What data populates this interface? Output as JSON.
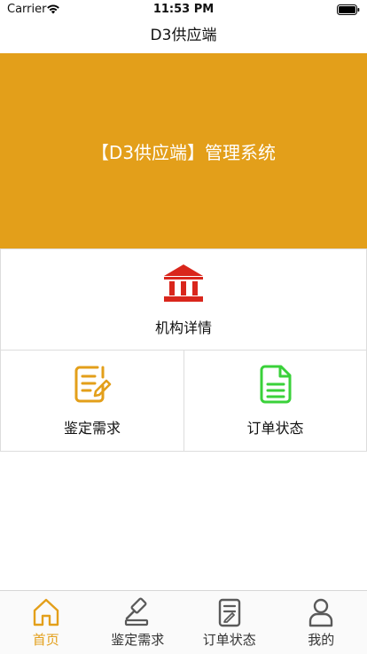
{
  "status_bar": {
    "carrier": "Carrier",
    "time": "11:53 PM"
  },
  "nav": {
    "title": "D3供应端"
  },
  "banner": {
    "text": "【D3供应端】管理系统",
    "color": "#e39f1a"
  },
  "menu": {
    "institution": {
      "label": "机构详情",
      "icon": "bank-icon",
      "color": "#d9261c"
    },
    "appraisal": {
      "label": "鉴定需求",
      "icon": "edit-note-icon",
      "color": "#e39f1a"
    },
    "order_status": {
      "label": "订单状态",
      "icon": "document-icon",
      "color": "#3ad13a"
    }
  },
  "tabs": [
    {
      "label": "首页",
      "icon": "home-icon",
      "active": true
    },
    {
      "label": "鉴定需求",
      "icon": "gavel-icon",
      "active": false
    },
    {
      "label": "订单状态",
      "icon": "clipboard-icon",
      "active": false
    },
    {
      "label": "我的",
      "icon": "user-icon",
      "active": false
    }
  ],
  "colors": {
    "accent": "#e39f1a",
    "tab_inactive": "#5a5a5a"
  }
}
